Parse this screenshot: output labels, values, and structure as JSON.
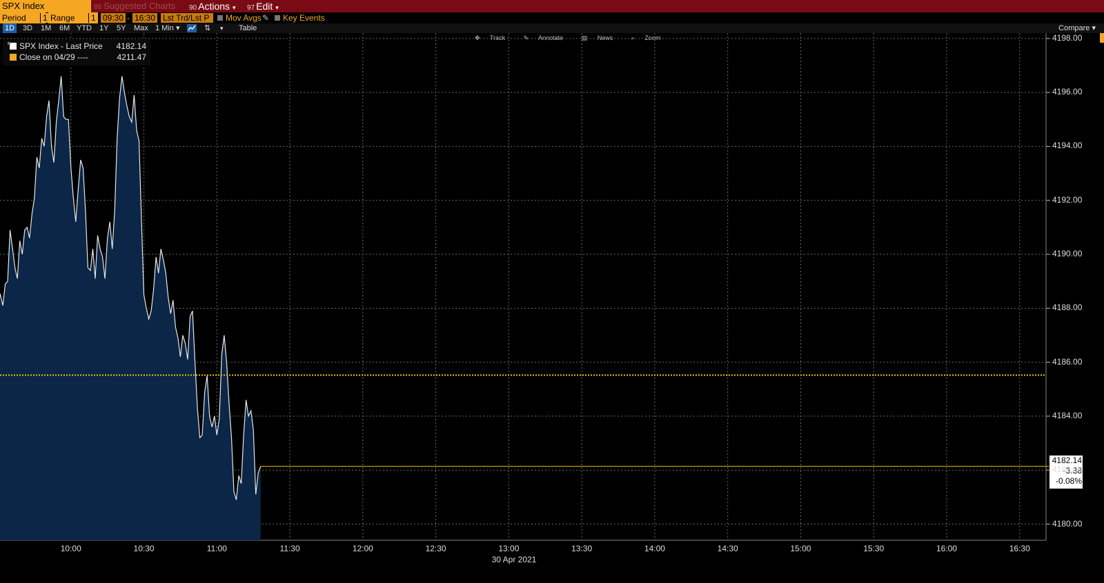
{
  "toolbar": {
    "ticker": "SPX Index",
    "suggested": {
      "num": "89",
      "label": "Suggested Charts"
    },
    "actions": {
      "num": "90",
      "label": "Actions"
    },
    "edit": {
      "num": "97",
      "label": "Edit"
    }
  },
  "settings": {
    "period_label": "Period",
    "period_value": "1",
    "range_label": "Range",
    "range_value": "1",
    "time_from": "09:30",
    "time_sep": "-",
    "time_to": "16:30",
    "field": "Lst Trd/Lst P",
    "mov_avgs": "Mov Avgs",
    "key_events": "Key Events"
  },
  "periods": [
    "1D",
    "3D",
    "1M",
    "6M",
    "YTD",
    "1Y",
    "5Y",
    "Max"
  ],
  "interval": "1 Min",
  "table_label": "Table",
  "compare_label": "Compare",
  "tools": [
    "Track",
    "Annotate",
    "News",
    "Zoom"
  ],
  "legend": {
    "series1_label": "SPX Index - Last Price",
    "series1_value": "4182.14",
    "series2_label": "Close on 04/29 ----",
    "series2_value": "4211.47"
  },
  "last_box": {
    "price": "4182.14",
    "change": "-3.38",
    "pct": "-0.08%"
  },
  "colors": {
    "accent": "#f5a623",
    "header": "#7a0b14",
    "area_fill": "#0b2647",
    "line": "#e8e8e8",
    "ref_line": "#f5c400"
  },
  "chart_data": {
    "type": "area",
    "title": "",
    "xlabel": "30 Apr 2021",
    "ylabel": "",
    "x_ticks": [
      "10:00",
      "10:30",
      "11:00",
      "11:30",
      "12:00",
      "12:30",
      "13:00",
      "13:30",
      "14:00",
      "14:30",
      "15:00",
      "15:30",
      "16:00",
      "16:30"
    ],
    "y_ticks": [
      "4198.00",
      "4196.00",
      "4194.00",
      "4192.00",
      "4190.00",
      "4188.00",
      "4186.00",
      "4184.00",
      "4182.00",
      "4180.00"
    ],
    "ylim": [
      4179.4,
      4198.2
    ],
    "xlim": [
      "09:30",
      "16:40"
    ],
    "grid": true,
    "legend_position": "top-left",
    "reference_line": {
      "name": "Close on 04/29",
      "value": 4185.52
    },
    "last_price_line": 4182.14,
    "series": [
      {
        "name": "SPX Index - Last Price",
        "points": [
          [
            "09:30",
            4188.2
          ],
          [
            "09:31",
            4188.5
          ],
          [
            "09:32",
            4188.1
          ],
          [
            "09:33",
            4188.9
          ],
          [
            "09:34",
            4189.0
          ],
          [
            "09:35",
            4190.9
          ],
          [
            "09:36",
            4190.2
          ],
          [
            "09:37",
            4189.5
          ],
          [
            "09:38",
            4189.1
          ],
          [
            "09:39",
            4190.5
          ],
          [
            "09:40",
            4190.0
          ],
          [
            "09:41",
            4190.9
          ],
          [
            "09:42",
            4191.0
          ],
          [
            "09:43",
            4190.6
          ],
          [
            "09:44",
            4191.5
          ],
          [
            "09:45",
            4192.1
          ],
          [
            "09:46",
            4193.6
          ],
          [
            "09:47",
            4193.2
          ],
          [
            "09:48",
            4194.3
          ],
          [
            "09:49",
            4194.0
          ],
          [
            "09:50",
            4195.1
          ],
          [
            "09:51",
            4195.7
          ],
          [
            "09:52",
            4194.0
          ],
          [
            "09:53",
            4193.4
          ],
          [
            "09:54",
            4194.9
          ],
          [
            "09:55",
            4195.7
          ],
          [
            "09:56",
            4196.6
          ],
          [
            "09:57",
            4195.1
          ],
          [
            "09:58",
            4195.0
          ],
          [
            "09:59",
            4195.0
          ],
          [
            "10:00",
            4193.2
          ],
          [
            "10:01",
            4192.1
          ],
          [
            "10:02",
            4191.2
          ],
          [
            "10:03",
            4192.4
          ],
          [
            "10:04",
            4193.5
          ],
          [
            "10:05",
            4193.2
          ],
          [
            "10:06",
            4191.6
          ],
          [
            "10:07",
            4189.5
          ],
          [
            "10:08",
            4189.4
          ],
          [
            "10:09",
            4190.2
          ],
          [
            "10:10",
            4189.1
          ],
          [
            "10:11",
            4190.7
          ],
          [
            "10:12",
            4190.2
          ],
          [
            "10:13",
            4189.9
          ],
          [
            "10:14",
            4189.1
          ],
          [
            "10:15",
            4190.6
          ],
          [
            "10:16",
            4191.2
          ],
          [
            "10:17",
            4190.2
          ],
          [
            "10:18",
            4191.6
          ],
          [
            "10:19",
            4194.3
          ],
          [
            "10:20",
            4195.8
          ],
          [
            "10:21",
            4196.6
          ],
          [
            "10:22",
            4196.0
          ],
          [
            "10:23",
            4195.5
          ],
          [
            "10:24",
            4195.1
          ],
          [
            "10:25",
            4194.9
          ],
          [
            "10:26",
            4195.9
          ],
          [
            "10:27",
            4194.6
          ],
          [
            "10:28",
            4194.2
          ],
          [
            "10:29",
            4191.3
          ],
          [
            "10:30",
            4188.5
          ],
          [
            "10:31",
            4188.0
          ],
          [
            "10:32",
            4187.6
          ],
          [
            "10:33",
            4187.9
          ],
          [
            "10:34",
            4188.7
          ],
          [
            "10:35",
            4189.9
          ],
          [
            "10:36",
            4189.3
          ],
          [
            "10:37",
            4190.2
          ],
          [
            "10:38",
            4189.8
          ],
          [
            "10:39",
            4189.3
          ],
          [
            "10:40",
            4188.4
          ],
          [
            "10:41",
            4187.8
          ],
          [
            "10:42",
            4188.3
          ],
          [
            "10:43",
            4187.3
          ],
          [
            "10:44",
            4186.9
          ],
          [
            "10:45",
            4186.2
          ],
          [
            "10:46",
            4187.0
          ],
          [
            "10:47",
            4186.7
          ],
          [
            "10:48",
            4186.1
          ],
          [
            "10:49",
            4187.7
          ],
          [
            "10:50",
            4187.9
          ],
          [
            "10:51",
            4186.0
          ],
          [
            "10:52",
            4184.3
          ],
          [
            "10:53",
            4183.2
          ],
          [
            "10:54",
            4183.3
          ],
          [
            "10:55",
            4184.9
          ],
          [
            "10:56",
            4185.5
          ],
          [
            "10:57",
            4184.0
          ],
          [
            "10:58",
            4183.6
          ],
          [
            "10:59",
            4184.0
          ],
          [
            "11:00",
            4183.3
          ],
          [
            "11:01",
            4183.9
          ],
          [
            "11:02",
            4186.3
          ],
          [
            "11:03",
            4187.0
          ],
          [
            "11:04",
            4186.0
          ],
          [
            "11:05",
            4184.5
          ],
          [
            "11:06",
            4183.2
          ],
          [
            "11:07",
            4181.2
          ],
          [
            "11:08",
            4180.9
          ],
          [
            "11:09",
            4181.8
          ],
          [
            "11:10",
            4181.5
          ],
          [
            "11:11",
            4183.3
          ],
          [
            "11:12",
            4184.6
          ],
          [
            "11:13",
            4184.0
          ],
          [
            "11:14",
            4184.2
          ],
          [
            "11:15",
            4183.5
          ],
          [
            "11:16",
            4181.1
          ],
          [
            "11:17",
            4181.9
          ],
          [
            "11:18",
            4182.14
          ]
        ]
      }
    ]
  }
}
